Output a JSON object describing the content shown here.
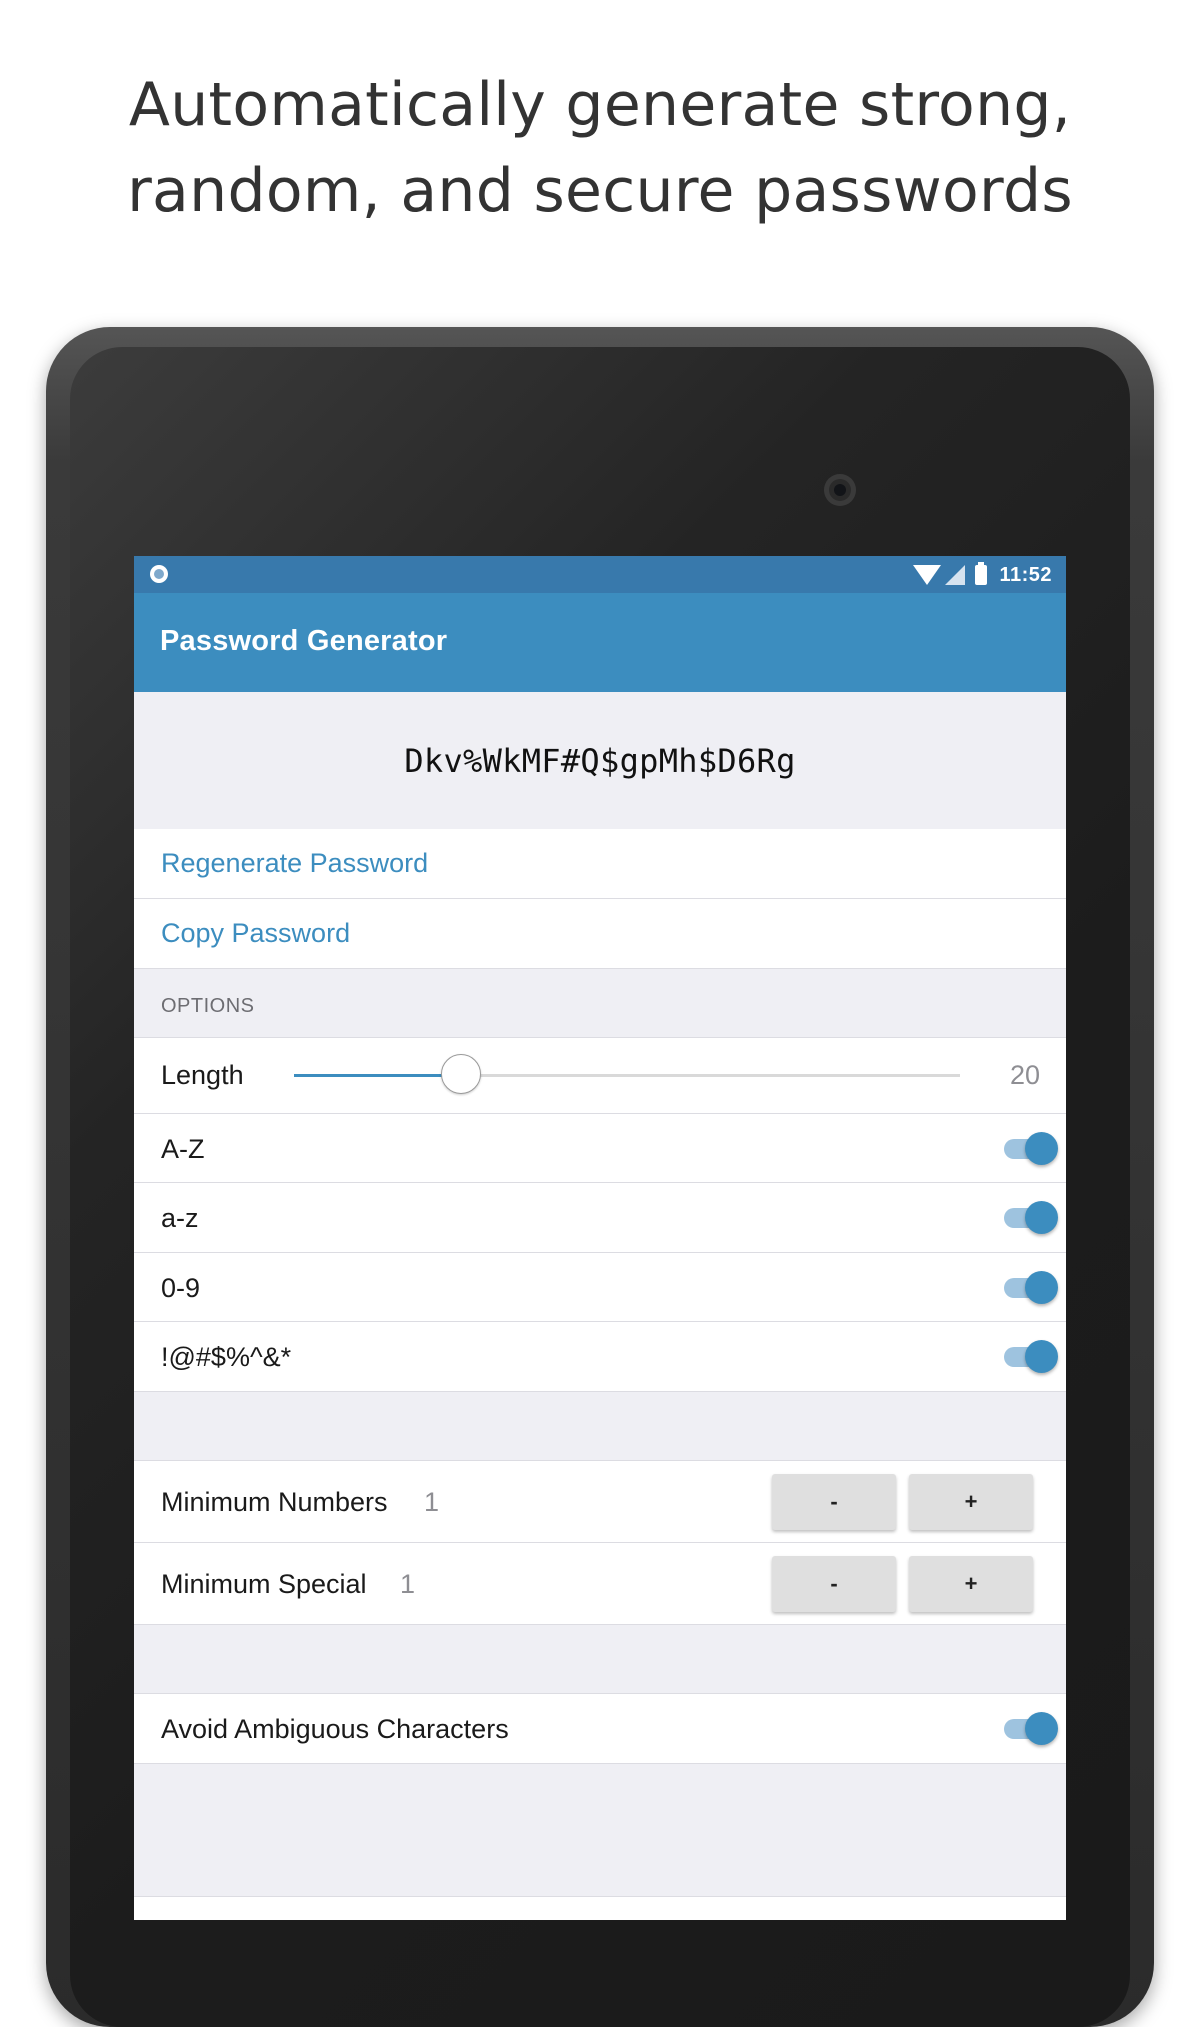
{
  "headline": {
    "line1": "Automatically generate strong,",
    "line2": "random, and secure passwords"
  },
  "statusbar": {
    "time": "11:52",
    "icons": [
      "notification-icon",
      "wifi-icon",
      "signal-icon",
      "battery-icon"
    ]
  },
  "appbar": {
    "title": "Password Generator"
  },
  "password": {
    "value": "Dkv%WkMF#Q$gpMh$D6Rg"
  },
  "actions": {
    "regenerate": "Regenerate Password",
    "copy": "Copy Password"
  },
  "options": {
    "header": "OPTIONS",
    "length": {
      "label": "Length",
      "value": "20",
      "min": 5,
      "max": 64,
      "fraction": 0.25
    },
    "uppercase": {
      "label": "A-Z",
      "on": true
    },
    "lowercase": {
      "label": "a-z",
      "on": true
    },
    "numbers": {
      "label": "0-9",
      "on": true
    },
    "special": {
      "label": "!@#$%^&*",
      "on": true
    },
    "min_numbers": {
      "label": "Minimum Numbers",
      "value": "1",
      "minus": "-",
      "plus": "+"
    },
    "min_special": {
      "label": "Minimum Special",
      "value": "1",
      "minus": "-",
      "plus": "+"
    },
    "ambiguous": {
      "label": "Avoid Ambiguous Characters",
      "on": true
    }
  },
  "colors": {
    "accent": "#3c8dbf",
    "statusbar": "#3879ac",
    "link": "#3c8dbf",
    "background": "#efeff4"
  }
}
